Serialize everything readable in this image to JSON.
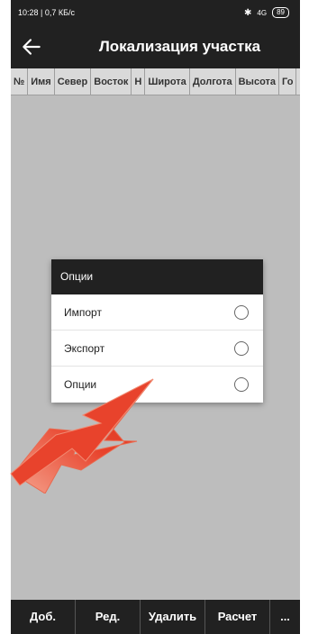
{
  "status": {
    "time_speed": "10:28 | 0,7 КБ/с",
    "battery": "89",
    "network": "4G"
  },
  "appbar": {
    "title": "Локализация участка"
  },
  "table": {
    "columns": [
      "№",
      "Имя",
      "Север",
      "Восток",
      "H",
      "Широта",
      "Долгота",
      "Высота",
      "Го"
    ]
  },
  "dialog": {
    "title": "Опции",
    "options": [
      {
        "label": "Импорт",
        "selected": false
      },
      {
        "label": "Экспорт",
        "selected": false
      },
      {
        "label": "Опции",
        "selected": false
      }
    ]
  },
  "bottom": {
    "buttons": [
      "Доб.",
      "Ред.",
      "Удалить",
      "Расчет",
      "..."
    ]
  },
  "colors": {
    "bar": "#212121",
    "background": "#bdbdbd",
    "arrow": "#e8432c"
  }
}
